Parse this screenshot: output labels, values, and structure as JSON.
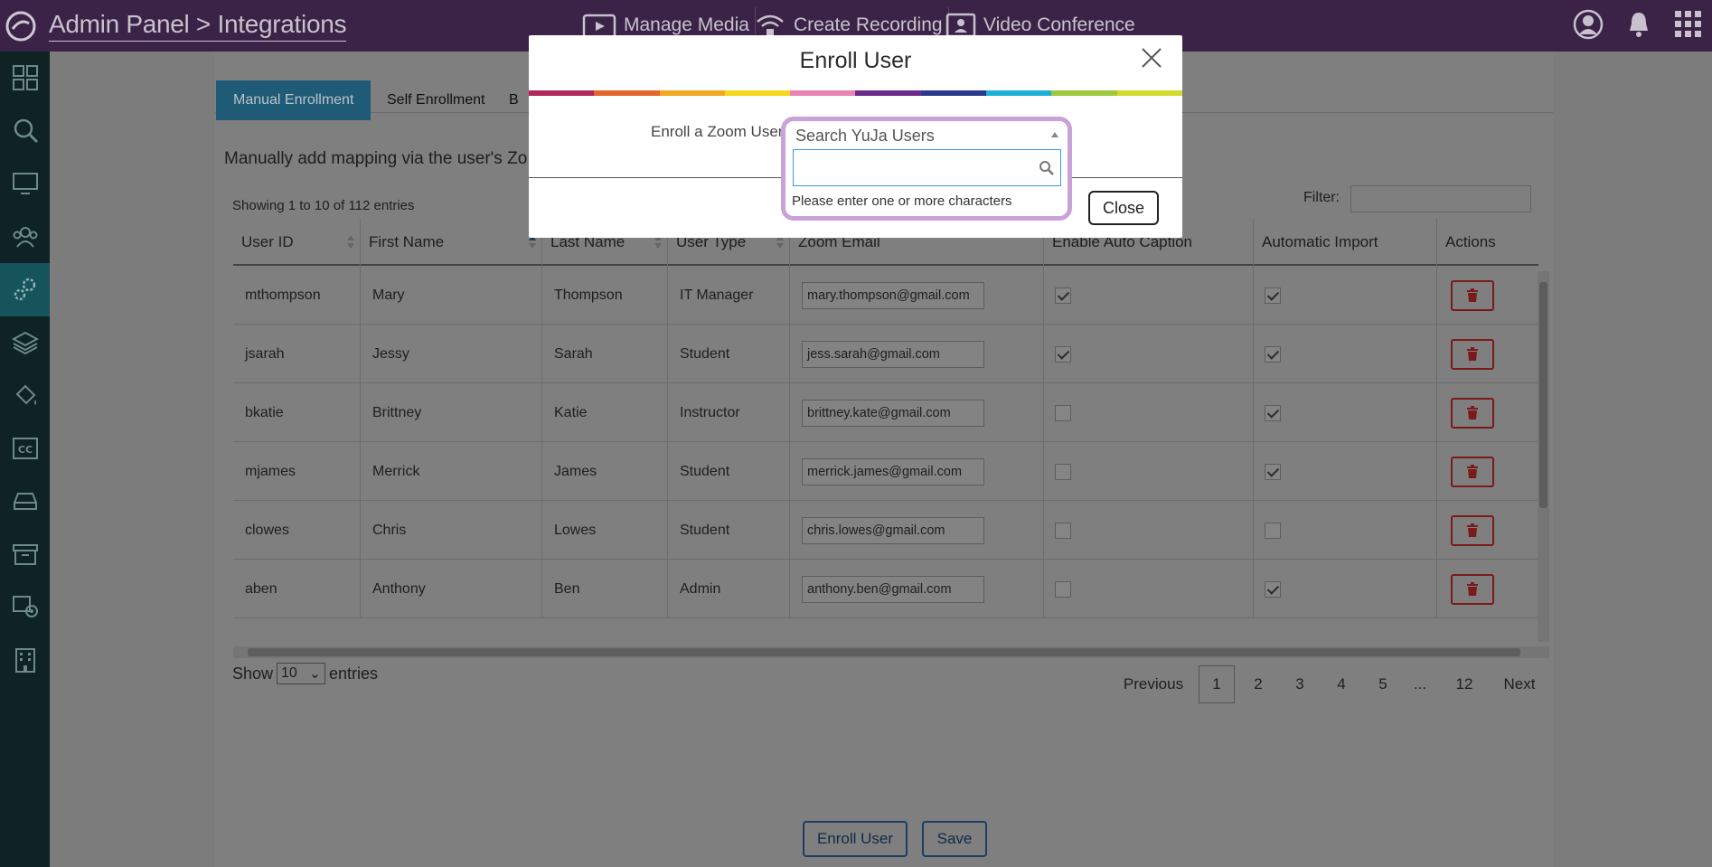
{
  "header": {
    "breadcrumb": "Admin Panel > Integrations",
    "nav": [
      {
        "label": "Manage Media",
        "icon": "media-player-icon"
      },
      {
        "label": "Create Recording",
        "icon": "broadcast-icon"
      },
      {
        "label": "Video Conference",
        "icon": "video-conference-icon"
      }
    ]
  },
  "sidebar": {
    "items": [
      "dashboard-icon",
      "search-icon",
      "monitor-icon",
      "group-icon",
      "settings-icon",
      "layers-icon",
      "paint-bucket-icon",
      "closed-caption-icon",
      "storage-drive-icon",
      "archive-icon",
      "device-camera-icon",
      "building-icon"
    ],
    "active_index": 4
  },
  "tabs": {
    "manual": "Manual Enrollment",
    "self": "Self Enrollment",
    "bulk": "B"
  },
  "intro": "Manually add mapping via the user's Zo",
  "showing": "Showing 1 to 10 of 112 entries",
  "filter_label": "Filter:",
  "table": {
    "headers": [
      "User ID",
      "First Name",
      "Last Name",
      "User Type",
      "Zoom Email",
      "Enable Auto Caption",
      "Automatic Import",
      "Actions"
    ],
    "rows": [
      {
        "user_id": "mthompson",
        "first": "Mary",
        "last": "Thompson",
        "type": "IT Manager",
        "email": "mary.thompson@gmail.com",
        "caption": true,
        "import": true
      },
      {
        "user_id": "jsarah",
        "first": "Jessy",
        "last": "Sarah",
        "type": "Student",
        "email": "jess.sarah@gmail.com",
        "caption": true,
        "import": true
      },
      {
        "user_id": "bkatie",
        "first": "Brittney",
        "last": "Katie",
        "type": "Instructor",
        "email": "brittney.kate@gmail.com",
        "caption": false,
        "import": true
      },
      {
        "user_id": "mjames",
        "first": "Merrick",
        "last": "James",
        "type": "Student",
        "email": "merrick.james@gmail.com",
        "caption": false,
        "import": true
      },
      {
        "user_id": "clowes",
        "first": "Chris",
        "last": "Lowes",
        "type": "Student",
        "email": "chris.lowes@gmail.com",
        "caption": false,
        "import": false
      },
      {
        "user_id": "aben",
        "first": "Anthony",
        "last": "Ben",
        "type": "Admin",
        "email": "anthony.ben@gmail.com",
        "caption": false,
        "import": true
      }
    ]
  },
  "length_menu": {
    "show": "Show",
    "value": "10",
    "entries": "entries"
  },
  "pagination": {
    "previous": "Previous",
    "pages": [
      "1",
      "2",
      "3",
      "4",
      "5",
      "...",
      "12"
    ],
    "next": "Next",
    "current": "1"
  },
  "buttons": {
    "enroll": "Enroll User",
    "save": "Save"
  },
  "modal": {
    "title": "Enroll User",
    "label": "Enroll a Zoom User",
    "select_placeholder": "Search YuJa Users",
    "search_message": "Please enter one or more characters",
    "close": "Close",
    "rainbow_colors": [
      "#b2285a",
      "#e4662b",
      "#f2a722",
      "#f5d81e",
      "#e884b3",
      "#6a2b8a",
      "#2b3a8f",
      "#1cb0d6",
      "#9fc93c",
      "#d3d92f"
    ]
  }
}
